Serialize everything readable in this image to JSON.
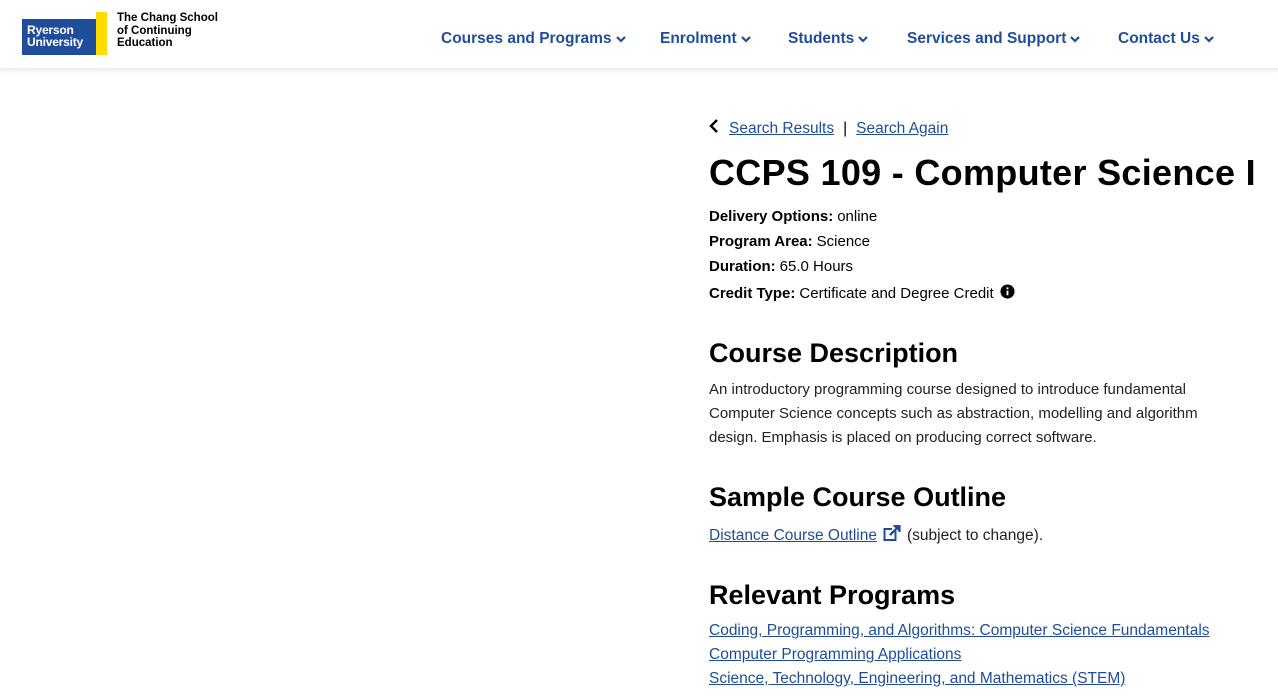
{
  "brand": {
    "university_line1": "Ryerson",
    "university_line2": "University",
    "school_line1": "The Chang School",
    "school_line2": "of Continuing",
    "school_line3": "Education",
    "primary_color": "#1f4d9b",
    "accent_color": "#ffdc00"
  },
  "nav": {
    "items": [
      {
        "label": "Courses and Programs",
        "icon": "chevron-down-icon"
      },
      {
        "label": "Enrolment",
        "icon": "chevron-down-icon"
      },
      {
        "label": "Students",
        "icon": "chevron-down-icon"
      },
      {
        "label": "Services and Support",
        "icon": "chevron-down-icon"
      },
      {
        "label": "Contact Us",
        "icon": "chevron-down-icon"
      }
    ]
  },
  "breadcrumb": {
    "back_icon": "chevron-left-icon",
    "search_results": "Search Results",
    "separator": "|",
    "search_again": "Search Again"
  },
  "course": {
    "title": "CCPS 109 - Computer Science I",
    "delivery_label": "Delivery Options:",
    "delivery_value": "online",
    "area_label": "Program Area:",
    "area_value": "Science",
    "duration_label": "Duration:",
    "duration_value": "65.0 Hours",
    "credit_label": "Credit Type:",
    "credit_value": "Certificate and Degree Credit",
    "credit_icon": "info-icon"
  },
  "description": {
    "heading": "Course Description",
    "text": "An introductory programming course designed to introduce fundamental Computer Science concepts such as abstraction, modelling and algorithm design. Emphasis is placed on producing correct software."
  },
  "outline": {
    "heading": "Sample Course Outline",
    "link": "Distance Course Outline",
    "link_icon": "external-link-icon",
    "suffix": "(subject to change)."
  },
  "programs": {
    "heading": "Relevant Programs",
    "items": [
      "Coding, Programming, and Algorithms: Computer Science Fundamentals",
      "Computer Programming Applications",
      "Science, Technology, Engineering, and Mathematics (STEM)"
    ]
  }
}
